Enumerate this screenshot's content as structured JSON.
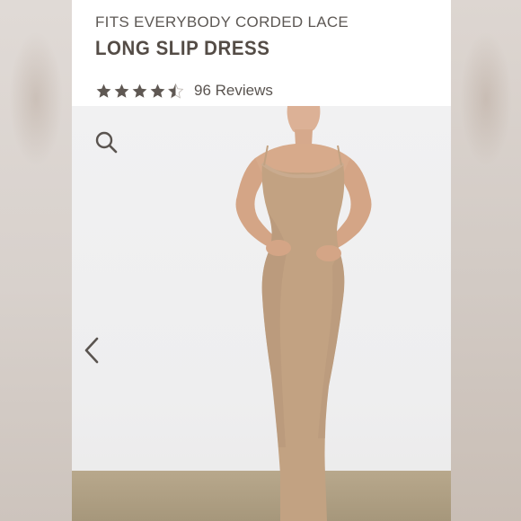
{
  "product": {
    "collection": "FITS EVERYBODY CORDED LACE",
    "name": "LONG SLIP DRESS",
    "rating": 4.5,
    "rating_max": 5,
    "reviews_label": "96 Reviews"
  },
  "icons": {
    "search": "search-icon",
    "previous": "chevron-left-icon",
    "star": "star-icon"
  },
  "colors": {
    "title": "#544c46",
    "star": "#5f5853",
    "dress": "#c2a282",
    "floor": "#b8a88c"
  }
}
